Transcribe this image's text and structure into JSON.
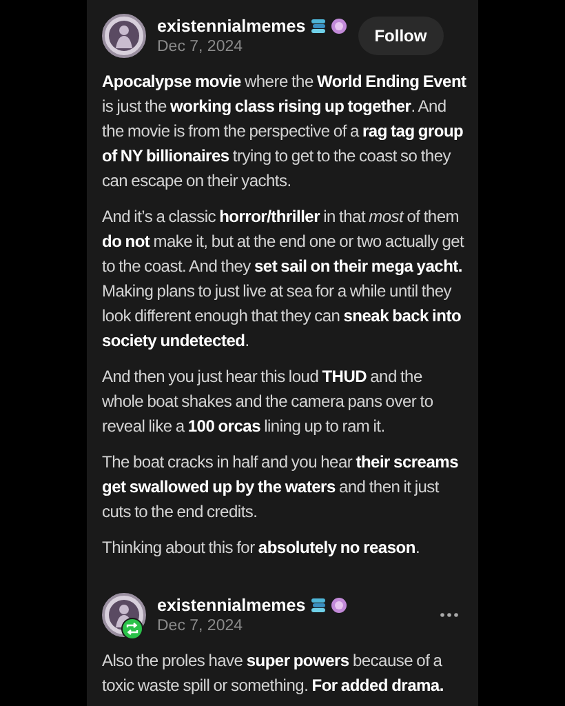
{
  "posts": [
    {
      "username": "existennialmemes",
      "date": "Dec 7, 2024",
      "reblogged": false,
      "follow_button": "Follow",
      "paragraphs": [
        "**Apocalypse movie** where the **World Ending Event** is just the **working class rising up together**. And the movie is from the perspective of a **rag tag group of NY billionaires** trying to get to the coast so they can escape on their yachts.",
        "And it’s a classic **horror/thriller** in that *most* of them **do not** make it, but at the end one or two actually get to the coast. And they **set sail on their mega yacht.** Making plans to just live at sea for a while until they look different enough that they can **sneak back into society undetected**.",
        "And then you just hear this loud **THUD** and the whole boat shakes and the camera pans over to reveal like a **100 orcas** lining up to ram it.",
        "The boat cracks in half and you hear **their screams get swallowed up by the waters** and then it just cuts to the end credits.",
        "Thinking about this for **absolutely no reason**."
      ]
    },
    {
      "username": "existennialmemes",
      "date": "Dec 7, 2024",
      "reblogged": true,
      "paragraphs": [
        "Also the proles have **super powers** because of a toxic waste spill or something. **For added drama.**"
      ]
    }
  ]
}
